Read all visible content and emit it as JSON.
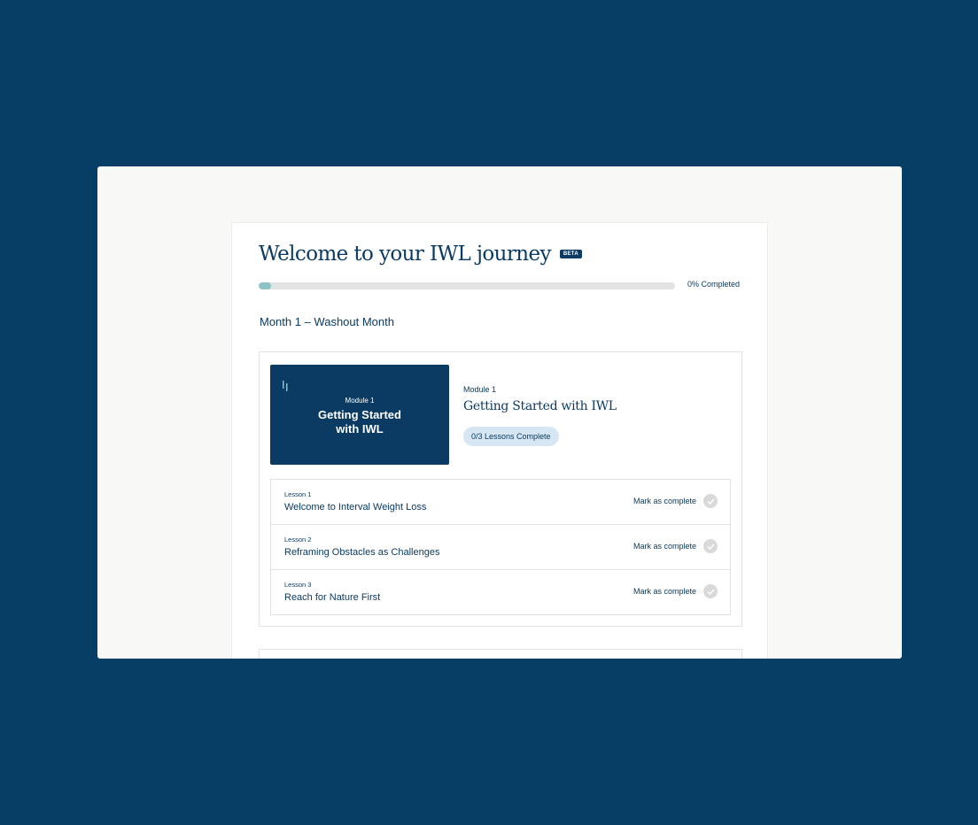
{
  "header": {
    "title": "Welcome to your IWL journey",
    "badge": "BETA"
  },
  "progress": {
    "value_percent": 3,
    "label": "0% Completed"
  },
  "month": {
    "title": "Month 1 – Washout Month"
  },
  "module": {
    "thumbnail": {
      "module_label": "Module 1",
      "title": "Getting Started with IWL"
    },
    "label": "Module 1",
    "title": "Getting Started with IWL",
    "lessons_status": "0/3 Lessons Complete"
  },
  "lessons": [
    {
      "number": "Lesson 1",
      "title": "Welcome to Interval Weight Loss",
      "action": "Mark as complete"
    },
    {
      "number": "Lesson 2",
      "title": "Reframing Obstacles as Challenges",
      "action": "Mark as complete"
    },
    {
      "number": "Lesson 3",
      "title": "Reach for Nature First",
      "action": "Mark as complete"
    }
  ],
  "colors": {
    "background": "#063e66",
    "navy": "#0b3b63",
    "progress_fill": "#8ec3c8",
    "pill": "#d6e6f2"
  },
  "icons": {
    "logo": "iwl-logo-icon",
    "check": "check-circle-icon"
  }
}
